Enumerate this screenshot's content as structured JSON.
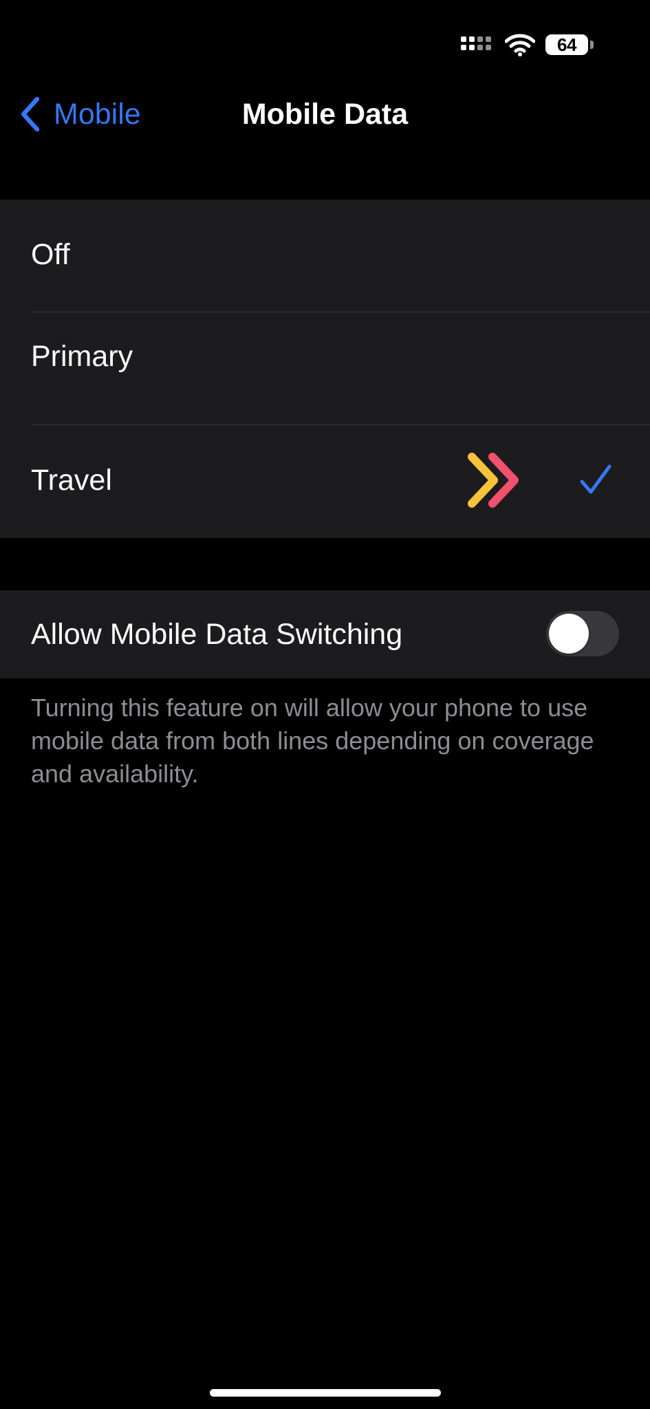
{
  "status_bar": {
    "battery_level": "64",
    "signal_icon": "cellular-signal-icon",
    "wifi_icon": "wifi-icon"
  },
  "nav": {
    "back_label": "Mobile",
    "title": "Mobile Data",
    "back_icon": "chevron-left-icon"
  },
  "options": [
    {
      "label": "Off",
      "selected": false
    },
    {
      "label": "Primary",
      "selected": false
    },
    {
      "label": "Travel",
      "selected": true
    }
  ],
  "data_switching": {
    "label": "Allow Mobile Data Switching",
    "enabled": false,
    "footnote": "Turning this feature on will allow your phone to use mobile data from both lines depending on coverage and availability."
  },
  "colors": {
    "accent": "#3478f6",
    "background": "#000000",
    "group_background": "#1c1c1e",
    "separator": "#38383a",
    "secondary_text": "#8d8d93",
    "logo_yellow": "#f8c23a",
    "logo_pink": "#f2506c"
  }
}
